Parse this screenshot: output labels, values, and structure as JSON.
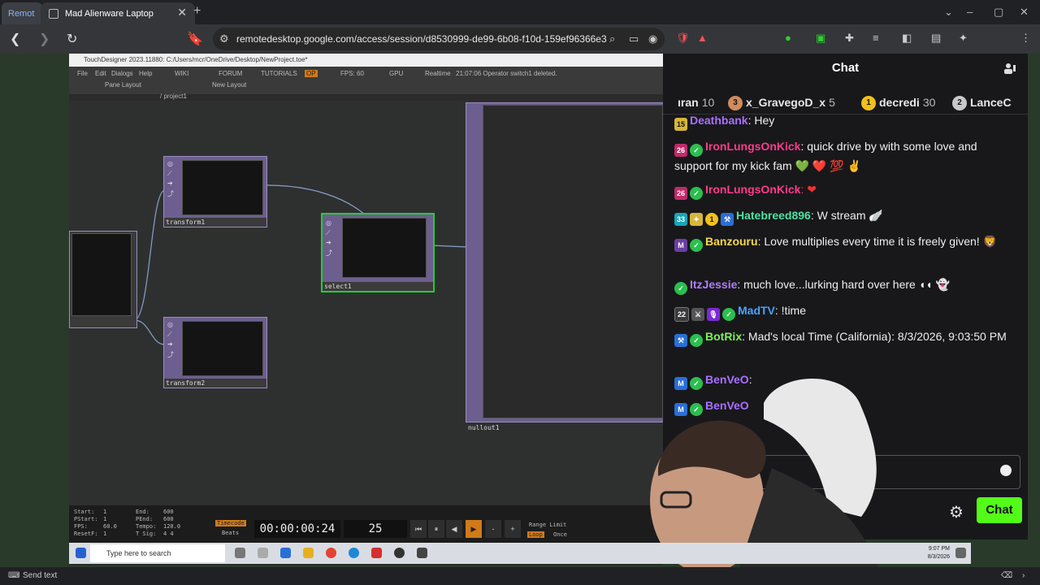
{
  "browser": {
    "tabs": [
      {
        "label": "Remot"
      },
      {
        "label": "Mad Alienware Laptop"
      }
    ],
    "url": "remotedesktop.google.com/access/session/d8530999-de99-6b08-f10d-159ef96366e3"
  },
  "td": {
    "title": "TouchDesigner 2023.11880: C:/Users/mcr/OneDrive/Desktop/NewProject.toe*",
    "menu": [
      "File",
      "Edit",
      "Dialogs",
      "Help"
    ],
    "menu_right": [
      "WIKI",
      "FORUM",
      "TUTORIALS",
      "OP",
      "FPS: 60",
      "GPU",
      "Realtime",
      "21:07:06 Operator switch1 deleted."
    ],
    "pane_layout": "Pane Layout",
    "new_layout": "New Layout",
    "path": "/ project1",
    "operators": [
      {
        "name": "transform1"
      },
      {
        "name": "select1"
      },
      {
        "name": "transform2"
      },
      {
        "name": "nullout1"
      }
    ],
    "stats": {
      "start": "Start:",
      "start_v": "1",
      "end": "End:",
      "end_v": "600",
      "pstart": "PStart:",
      "pstart_v": "1",
      "pend": "PEnd:",
      "pend_v": "600",
      "fps": "FPS:",
      "fps_v": "60.0",
      "tempo": "Tempo:",
      "tempo_v": "120.0",
      "resetf": "ResetF:",
      "resetf_v": "1",
      "tsig": "T Sig:",
      "tsig_v": "4   4"
    },
    "timecode_tab": "Timecode",
    "beats_tab": "Beats",
    "timecode": "00:00:00:24",
    "frame": "25",
    "range_limit": "Range Limit",
    "loop": "Loop",
    "once": "Once"
  },
  "chat": {
    "header": "Chat",
    "leaderboard": [
      {
        "name": "ıran",
        "score": "10",
        "rank": ""
      },
      {
        "name": "x_GravegoD_x",
        "score": "5",
        "rank": "3"
      },
      {
        "name": "decredi",
        "score": "30",
        "rank": "1"
      },
      {
        "name": "LanceC",
        "score": "",
        "rank": "2"
      }
    ],
    "messages": [
      {
        "badge": "15",
        "user": "Deathbank",
        "text": ": Hey",
        "color": "#a970ff"
      },
      {
        "badge": "26",
        "user": "IronLungsOnKick",
        "text": ": quick drive by with some love and support for my kick fam 💚 ❤️ 💯 ✌",
        "color": "#ff3b8a"
      },
      {
        "badge": "26",
        "user": "IronLungsOnKick",
        "text": ": ❤",
        "color": "#ff3b8a"
      },
      {
        "badge": "33",
        "user": "Hatebreed896",
        "text": ": W stream 🪽",
        "color": "#4be3a0"
      },
      {
        "badge": "M",
        "user": "Banzouru",
        "text": ": Love multiplies every time it is freely given! 🦁",
        "color": "#f5d84b"
      },
      {
        "badge": "",
        "user": "ItzJessie",
        "text": ": much love...lurking hard over here ◖◖ 👻",
        "color": "#b07cff"
      },
      {
        "badge": "22",
        "user": "MadTV",
        "text": ": !time",
        "color": "#4aa3ff"
      },
      {
        "badge": "",
        "user": "BotRix",
        "text": ": Mad's local Time (California): 8/3/2026, 9:03:50 PM",
        "color": "#7ef05a"
      },
      {
        "badge": "M",
        "user": "BenVeO",
        "text": ":",
        "color": "#a970ff"
      },
      {
        "badge": "M",
        "user": "BenVeO",
        "text": "",
        "color": "#a970ff"
      }
    ],
    "send_button": "Chat"
  },
  "taskbar": {
    "search_placeholder": "Type here to search",
    "time": "9:07 PM",
    "date": "8/3/2026"
  },
  "sendbar": {
    "label": "Send text"
  },
  "colors": {
    "kick_green": "#53fc18",
    "selected_op": "#1fd12f",
    "op_purple": "#6c5f8f"
  }
}
